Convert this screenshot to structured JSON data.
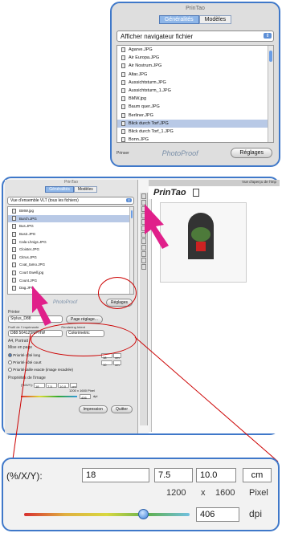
{
  "top": {
    "title": "PrinTao",
    "tabs": [
      "Généralités",
      "Modèles"
    ],
    "browser_select": "Afficher navigateur fichier",
    "files": [
      "Agarve.JPG",
      "Air Europa.JPG",
      "Air Nostrum.JPG",
      "Altar.JPG",
      "Aussichtsturm.JPG",
      "Aussichtsturm_1.JPG",
      "BMW.jpg",
      "Baum quer.JPG",
      "Berliner.JPG",
      "Blick durch Torf.JPG",
      "Blick durch Torf_1.JPG",
      "Bonn.JPG"
    ],
    "selected": "Blick durch Torf.JPG",
    "footer_left": "Prinser",
    "logo": "PhotoProof",
    "settings": "Réglages"
  },
  "mid": {
    "title": "PrinTao",
    "tabs": [
      "Généralités",
      "Modèles"
    ],
    "browser_select": "Vue d'ensemble VLT (tous les fichiers)",
    "files": [
      "BMW.jpg",
      "Burch.JPG",
      "Bus.JPG",
      "Bus2.JPG",
      "Cala Lhnigs.JPG",
      "Cloister.JPG",
      "Citrus.JPG",
      "Coat_tamo.JPG",
      "Court Ewell.jpg",
      "Count.JPG",
      "Dag.JPG"
    ],
    "selected": "Burch.JPG",
    "logo": "PhotoProof",
    "settings": "Réglages",
    "printer_label": "Printer",
    "printer": "Stylus_D88",
    "page_setup": "Page réglage...",
    "profile_label": "Profil de l' imprimante",
    "intent_label": "Rendering Intent",
    "profile": "D88 504125MPHW",
    "intent": "Colorimetric",
    "paper": "A4, Portrait",
    "layout_label": "Mise en page",
    "options": [
      "Priorité côté long",
      "Priorité côté court",
      "Priorité taille exacte (image recadrée)"
    ],
    "long_val": "18",
    "short_val": "10",
    "unit": "cm",
    "image_props": "Propriétés de l'image",
    "small_row_label": "(%/X/Y):",
    "small_vals": [
      "18",
      "7.5",
      "10.0",
      "cm"
    ],
    "small_dims": "1200 x 1600 Pixel",
    "small_dpi": "406",
    "small_dpi_unit": "dpi",
    "print_btn": "Impression",
    "quit_btn": "Quitter",
    "right_title": "Vue d'aperçu de l'imp",
    "brand": "PrinTao"
  },
  "zoom": {
    "label": "(%/X/Y):",
    "v1": "18",
    "v2": "7.5",
    "v3": "10.0",
    "unit": "cm",
    "w": "1200",
    "x": "x",
    "h": "1600",
    "pixel": "Pixel",
    "dpi": "406",
    "dpi_unit": "dpi",
    "slider_fraction": 0.72
  }
}
